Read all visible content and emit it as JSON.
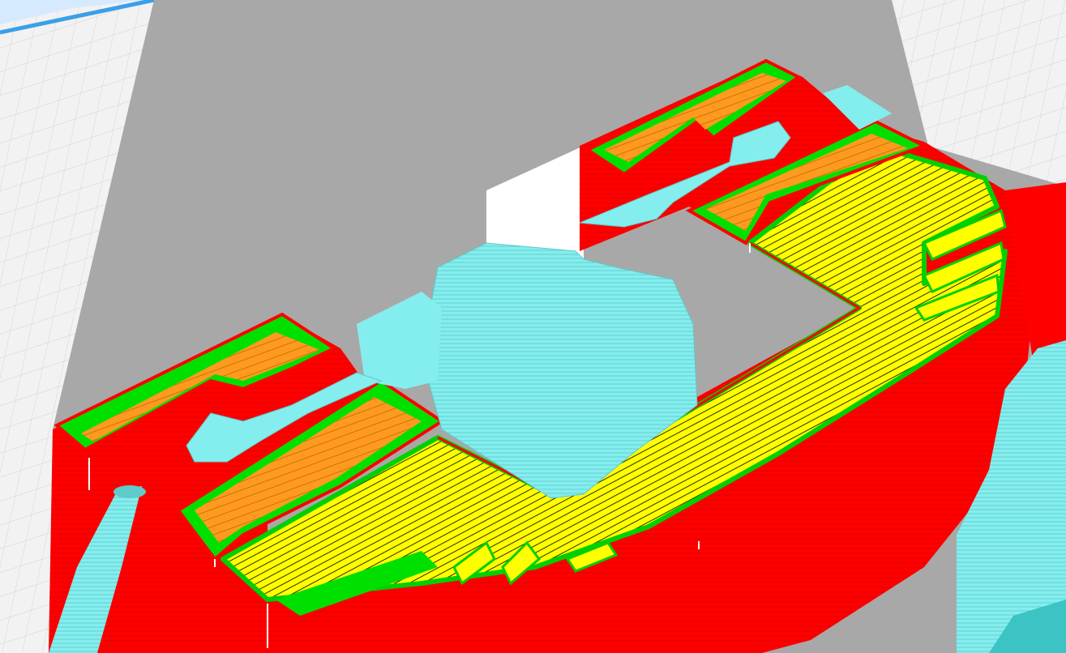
{
  "app": {
    "view": "layer-preview-3d",
    "grid_visible": true
  },
  "colors": {
    "background": "#f4f4f4",
    "build_plate_grid": "#d2d4d8",
    "build_plate_edge": "#3aa0e8",
    "model_shadow": "#a9a9a9",
    "wall_outer": "#ff0000",
    "wall_inner": "#00e000",
    "skin_top_bottom": "#ffff00",
    "infill": "#ff9a1f",
    "support": "#7eeaea",
    "travel_dark": "#111111"
  },
  "legend": {
    "items": []
  }
}
